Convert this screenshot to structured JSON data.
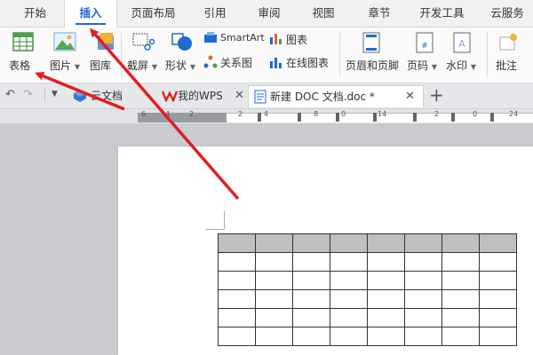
{
  "menubar": {
    "tabs": [
      "开始",
      "插入",
      "页面布局",
      "引用",
      "审阅",
      "视图",
      "章节",
      "开发工具",
      "云服务"
    ],
    "active_tab": "插入"
  },
  "ribbon": {
    "table": "表格",
    "picture": "图片",
    "gallery": "图库",
    "screenshot": "截屏",
    "shape": "形状",
    "smartart": "SmartArt",
    "relation": "关系图",
    "chart": "图表",
    "online_chart": "在线图表",
    "header_footer": "页眉和页脚",
    "page_number": "页码",
    "watermark": "水印",
    "comment": "批注"
  },
  "tabs": {
    "cloud": "云文档",
    "wps": "我的WPS",
    "doc": "新建 DOC 文档.doc *"
  },
  "ruler": {
    "labels": [
      "6",
      "4",
      "2",
      "2",
      "4",
      "8",
      "0",
      "14",
      "2",
      "0",
      "24"
    ]
  },
  "colors": {
    "accent": "#1f6bcf",
    "arrow": "#e02020",
    "table_header": "#bfbfbf"
  }
}
